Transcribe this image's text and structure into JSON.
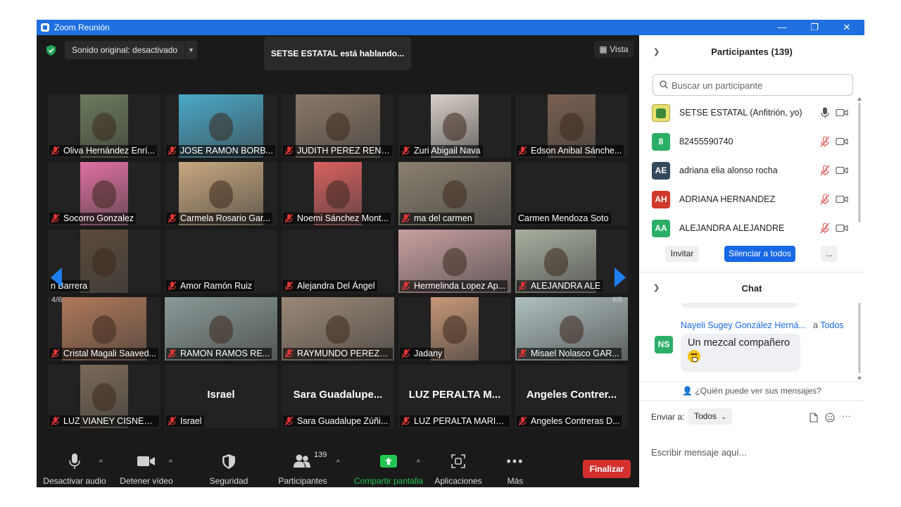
{
  "window": {
    "title": "Zoom Reunión",
    "minimize": "—",
    "restore": "❐",
    "close": "✕"
  },
  "topbar": {
    "sound": "Sonido original: desactivado",
    "speaking": "SETSE ESTATAL está hablando...",
    "view": "Vista"
  },
  "gallery": {
    "page": "4/6",
    "tiles": [
      {
        "label": "Oliva Hernández Enrí...",
        "muted": true,
        "big": "",
        "color": "#6a7a5a",
        "pic": [
          46,
          68
        ]
      },
      {
        "label": "JOSE RAMON BORB...",
        "muted": true,
        "big": "",
        "color": "#4aa8c8",
        "pic": [
          20,
          120
        ]
      },
      {
        "label": "JUDITH PEREZ REND...",
        "muted": true,
        "big": "",
        "color": "#8a7868",
        "pic": [
          20,
          120
        ]
      },
      {
        "label": "Zuri Abigail Nava",
        "muted": true,
        "big": "",
        "color": "#d8d0c8",
        "pic": [
          46,
          68
        ]
      },
      {
        "label": "Edson Anibal Sánche...",
        "muted": true,
        "big": "",
        "color": "#7a6050",
        "pic": [
          46,
          68
        ]
      },
      {
        "label": "Socorro Gonzalez",
        "muted": true,
        "big": "",
        "color": "#e070a0",
        "pic": [
          46,
          68
        ]
      },
      {
        "label": "Carmela Rosario Gar...",
        "muted": true,
        "big": "",
        "color": "#c8a880",
        "pic": [
          20,
          120
        ]
      },
      {
        "label": "Noemi Sánchez Mont...",
        "muted": true,
        "big": "",
        "color": "#d86060",
        "pic": [
          46,
          68
        ]
      },
      {
        "label": "ma del carmen",
        "muted": true,
        "big": "",
        "color": "#8a8070",
        "pic": [
          0,
          160
        ]
      },
      {
        "label": "Carmen Mendoza Soto",
        "muted": false,
        "big": "",
        "color": "",
        "pic": [
          0,
          0
        ]
      },
      {
        "label": "n Barrera",
        "muted": false,
        "big": "",
        "color": "#5a4a3a",
        "pic": [
          46,
          68
        ]
      },
      {
        "label": "Amor Ramón Ruiz",
        "muted": true,
        "big": "",
        "color": "",
        "pic": [
          0,
          0
        ]
      },
      {
        "label": "Alejandra Del Ángel",
        "muted": true,
        "big": "",
        "color": "",
        "pic": [
          0,
          0
        ]
      },
      {
        "label": "Hermelinda Lopez Ap...",
        "muted": true,
        "big": "",
        "color": "#c8a0a0",
        "pic": [
          0,
          160
        ]
      },
      {
        "label": "ALEJANDRA ALE",
        "muted": true,
        "big": "",
        "color": "#a8b0a0",
        "pic": [
          0,
          115
        ]
      },
      {
        "label": "Cristal Magali Saaved...",
        "muted": true,
        "big": "",
        "color": "#b07858",
        "pic": [
          20,
          120
        ]
      },
      {
        "label": "RAMON RAMOS RE...",
        "muted": true,
        "big": "",
        "color": "#8a9a98",
        "pic": [
          0,
          160
        ]
      },
      {
        "label": "RAYMUNDO PEREZ Z...",
        "muted": true,
        "big": "",
        "color": "#9a8878",
        "pic": [
          0,
          160
        ]
      },
      {
        "label": "Jadany",
        "muted": true,
        "big": "",
        "color": "#c89878",
        "pic": [
          46,
          68
        ]
      },
      {
        "label": "Misael Nolasco GAR...",
        "muted": true,
        "big": "",
        "color": "#b0c0c0",
        "pic": [
          0,
          160
        ]
      },
      {
        "label": "LUZ VIANEY CISNEROS",
        "muted": true,
        "big": "",
        "color": "#7a6a58",
        "pic": [
          46,
          68
        ]
      },
      {
        "label": "Israel",
        "muted": true,
        "big": "Israel",
        "color": "",
        "pic": [
          0,
          0
        ]
      },
      {
        "label": "Sara Guadalupe Zúñi...",
        "muted": true,
        "big": "Sara  Guadalupe...",
        "color": "",
        "pic": [
          0,
          0
        ]
      },
      {
        "label": "LUZ PERALTA MARIN...",
        "muted": true,
        "big": "LUZ PERALTA M...",
        "color": "",
        "pic": [
          0,
          0
        ]
      },
      {
        "label": "Angeles Contreras D...",
        "muted": true,
        "big": "Angeles  Contrer...",
        "color": "",
        "pic": [
          0,
          0
        ]
      }
    ]
  },
  "toolbar": {
    "mute": "Desactivar audio",
    "video": "Detener vídeo",
    "security": "Seguridad",
    "participants": "Participantes",
    "participants_count": "139",
    "share": "Compartir pantalla",
    "apps": "Aplicaciones",
    "more": "Más",
    "end": "Finalizar"
  },
  "panel": {
    "participants_title": "Participantes (139)",
    "search_placeholder": "Buscar un participante",
    "participants": [
      {
        "initials": "",
        "name": "SETSE ESTATAL (Anfitrión, yo)",
        "color": "#e8e070",
        "mic": "on"
      },
      {
        "initials": "8",
        "name": "82455590740",
        "color": "#2bae66",
        "mic": "muted"
      },
      {
        "initials": "AE",
        "name": "adriana elia alonso rocha",
        "color": "#34495e",
        "mic": "muted"
      },
      {
        "initials": "AH",
        "name": "ADRIANA HERNANDEZ",
        "color": "#d0392b",
        "mic": "muted"
      },
      {
        "initials": "AA",
        "name": "ALEJANDRA ALEJANDRE",
        "color": "#2bae66",
        "mic": "muted"
      }
    ],
    "invite": "Invitar",
    "mute_all": "Silenciar a todos",
    "more": "...",
    "chat_title": "Chat",
    "chat": {
      "avatar": "NS",
      "avatar_color": "#2bae66",
      "sender": "Nayeli Sugey González Herná...",
      "to_prefix": "a",
      "to": "Todos",
      "message": "Un mezcal compañero"
    },
    "who_sees": "¿Quién puede ver sus mensajes?",
    "send_to_label": "Enviar a:",
    "send_to_value": "Todos",
    "compose_placeholder": "Escribir mensaje aquí...",
    "accent": "#1768e5"
  }
}
